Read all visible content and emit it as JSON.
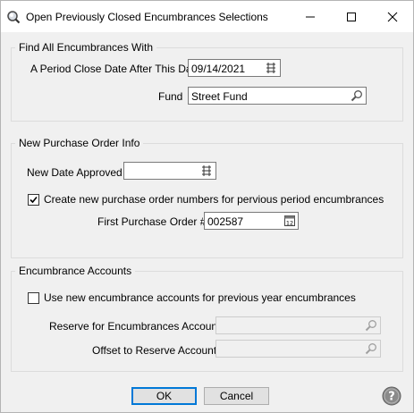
{
  "window": {
    "title": "Open Previously Closed Encumbrances Selections",
    "icons": {
      "app": "magnifier-app-icon",
      "minimize": "minimize-icon",
      "maximize": "maximize-icon",
      "close": "close-icon"
    }
  },
  "find_group": {
    "legend": "Find All Encumbrances With",
    "period_close_label": "A Period Close Date After This Date",
    "period_close_value": "09/14/2021",
    "fund_label": "Fund",
    "fund_value": "Street Fund"
  },
  "po_group": {
    "legend": "New Purchase Order Info",
    "date_approved_label": "New Date Approved",
    "date_approved_value": "",
    "create_new_checked": true,
    "create_new_label": "Create new purchase order numbers for pervious period encumbrances",
    "first_po_label": "First Purchase Order #",
    "first_po_value": "002587"
  },
  "accounts_group": {
    "legend": "Encumbrance Accounts",
    "use_new_checked": false,
    "use_new_label": "Use new encumbrance accounts for previous year encumbrances",
    "reserve_label": "Reserve for Encumbrances Account",
    "reserve_value": "",
    "offset_label": "Offset to Reserve Account",
    "offset_value": ""
  },
  "buttons": {
    "ok": "OK",
    "cancel": "Cancel"
  },
  "colors": {
    "default_button_border": "#0078d7",
    "help_icon": "#7a7a7a"
  }
}
